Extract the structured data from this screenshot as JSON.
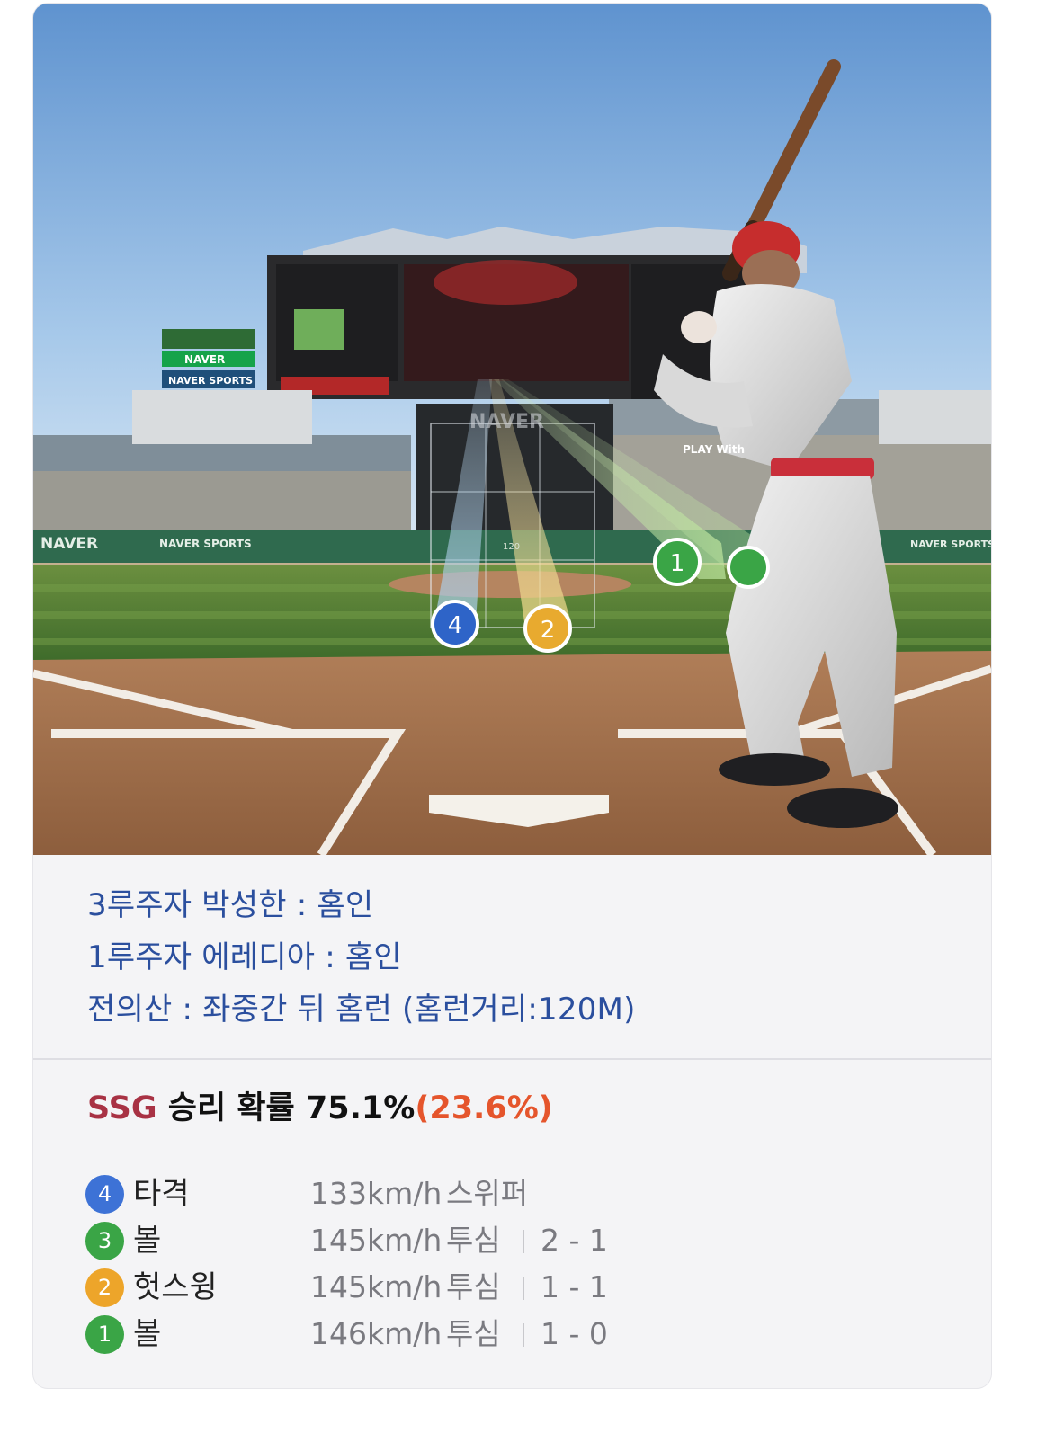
{
  "scene": {
    "scoreboard_brand": "NAVER",
    "signs": [
      "NAVER",
      "NAVER SPORTS",
      "NAVER",
      "NAVER SPORTS",
      "NAVER SPORTS",
      "PLAY With"
    ],
    "distance_marker": "120",
    "markers": [
      {
        "number": "1",
        "color": "#3aa546"
      },
      {
        "number": "2",
        "color": "#e8aa2f"
      },
      {
        "number": "4",
        "color": "#2e64c8"
      }
    ]
  },
  "runners": [
    "3루주자 박성한 : 홈인",
    "1루주자 에레디아 : 홈인",
    "전의산 : 좌중간 뒤 홈런 (홈런거리:120M)"
  ],
  "win_probability": {
    "team": "SSG",
    "label": " 승리 확률 75.1%",
    "delta": "(23.6%)",
    "team_color": "#a83244",
    "delta_color": "#e5552c"
  },
  "pitches": [
    {
      "number": "4",
      "color": "#3d72d6",
      "result": "타격",
      "speed": "133km/h",
      "type": "스위퍼",
      "count": ""
    },
    {
      "number": "3",
      "color": "#3aa546",
      "result": "볼",
      "speed": "145km/h",
      "type": "투심",
      "count": "2 - 1"
    },
    {
      "number": "2",
      "color": "#eda52a",
      "result": "헛스윙",
      "speed": "145km/h",
      "type": "투심",
      "count": "1 - 1"
    },
    {
      "number": "1",
      "color": "#3aa546",
      "result": "볼",
      "speed": "146km/h",
      "type": "투심",
      "count": "1 - 0"
    }
  ]
}
